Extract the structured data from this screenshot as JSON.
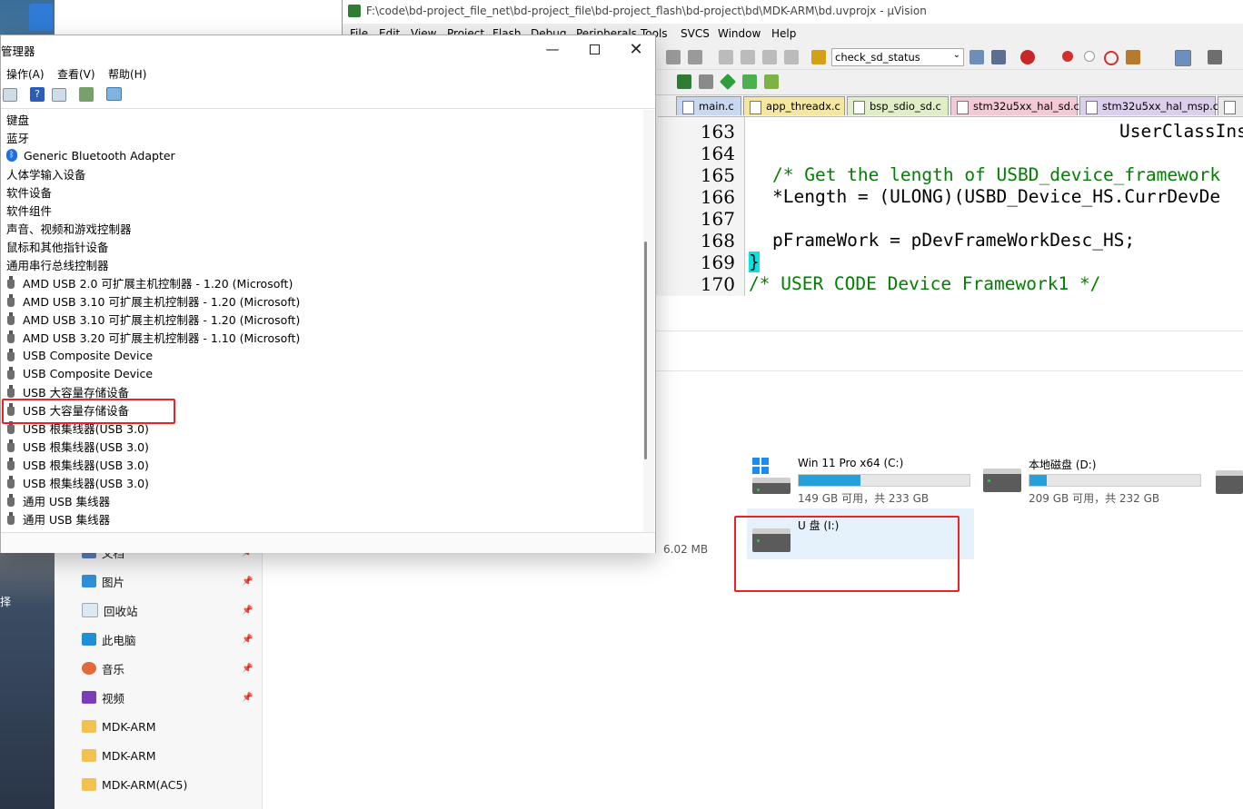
{
  "desktop": {
    "label": "择"
  },
  "uvision": {
    "title": "F:\\code\\bd-project_file_net\\bd-project_file\\bd-project_flash\\bd-project\\bd\\MDK-ARM\\bd.uvprojx - µVision",
    "menu": [
      "File",
      "Edit",
      "View",
      "Project",
      "Flash",
      "Debug",
      "Peripherals",
      "Tools",
      "SVCS",
      "Window",
      "Help"
    ],
    "target_select": "check_sd_status",
    "tabs": [
      "main.c",
      "app_threadx.c",
      "bsp_sdio_sd.c",
      "stm32u5xx_hal_sd.c",
      "stm32u5xx_hal_msp.c"
    ],
    "line_numbers": [
      "163",
      "164",
      "165",
      "166",
      "167",
      "168",
      "169",
      "170"
    ],
    "code": {
      "l163": "UserClassIns",
      "l165": "/* Get the length of USBD_device_framework",
      "l166": "*Length = (ULONG)(USBD_Device_HS.CurrDevDe",
      "l168": "pFrameWork = pDevFrameWorkDesc_HS;",
      "l169": "}",
      "l170": "/* USER CODE Device Framework1 */"
    },
    "colors": {
      "comment": "#008000",
      "tab_main": "#c8d8f0",
      "tab_thread": "#f5e6a0",
      "tab_bsp": "#e0eec8",
      "tab_hal_sd": "#f4c9d6",
      "tab_msp": "#dccfee"
    }
  },
  "device_manager": {
    "title": "管理器",
    "menu": {
      "action": "操作(A)",
      "view": "查看(V)",
      "help": "帮助(H)"
    },
    "tree": [
      "键盘",
      "蓝牙",
      "Generic Bluetooth Adapter",
      "人体学输入设备",
      "软件设备",
      "软件组件",
      "声音、视频和游戏控制器",
      "鼠标和其他指针设备",
      "通用串行总线控制器",
      "AMD USB 2.0 可扩展主机控制器 - 1.20 (Microsoft)",
      "AMD USB 3.10 可扩展主机控制器 - 1.20 (Microsoft)",
      "AMD USB 3.10 可扩展主机控制器 - 1.20 (Microsoft)",
      "AMD USB 3.20 可扩展主机控制器 - 1.10 (Microsoft)",
      "USB Composite Device",
      "USB Composite Device",
      "USB 大容量存储设备",
      "USB 大容量存储设备",
      "USB 根集线器(USB 3.0)",
      "USB 根集线器(USB 3.0)",
      "USB 根集线器(USB 3.0)",
      "USB 根集线器(USB 3.0)",
      "通用 USB 集线器",
      "通用 USB 集线器"
    ]
  },
  "explorer": {
    "nav": [
      "文档",
      "图片",
      "回收站",
      "此电脑",
      "音乐",
      "视频",
      "MDK-ARM",
      "MDK-ARM",
      "MDK-ARM(AC5)"
    ],
    "hidden_size": "6.02 MB",
    "drives": [
      {
        "name": "Win 11 Pro x64 (C:)",
        "size": "149 GB 可用，共 233 GB",
        "used": 0.36
      },
      {
        "name": "本地磁盘 (D:)",
        "size": "209 GB 可用，共 232 GB",
        "used": 0.1
      },
      {
        "name": "U 盘 (I:)",
        "size": ""
      }
    ]
  }
}
